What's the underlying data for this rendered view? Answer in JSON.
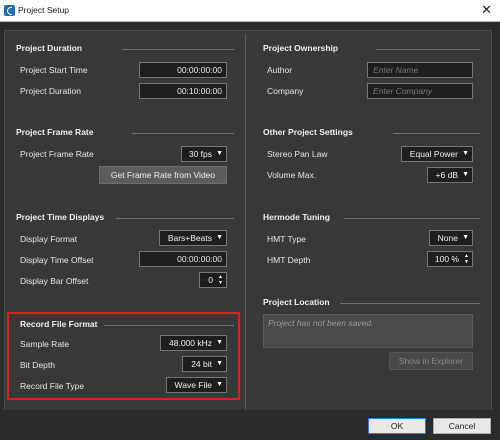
{
  "window": {
    "title": "Project Setup",
    "close_glyph": "✕"
  },
  "sections": {
    "project_duration": {
      "title": "Project Duration",
      "start_time_label": "Project Start Time",
      "start_time_value": "00:00:00:00",
      "duration_label": "Project Duration",
      "duration_value": "00:10:00:00"
    },
    "project_frame_rate": {
      "title": "Project Frame Rate",
      "frame_rate_label": "Project Frame Rate",
      "frame_rate_value": "30 fps",
      "get_from_video_button": "Get Frame Rate from Video"
    },
    "project_time_displays": {
      "title": "Project Time Displays",
      "display_format_label": "Display Format",
      "display_format_value": "Bars+Beats",
      "time_offset_label": "Display Time Offset",
      "time_offset_value": "00:00:00:00",
      "bar_offset_label": "Display Bar Offset",
      "bar_offset_value": "0"
    },
    "record_file_format": {
      "title": "Record File Format",
      "sample_rate_label": "Sample Rate",
      "sample_rate_value": "48.000 kHz",
      "bit_depth_label": "Bit Depth",
      "bit_depth_value": "24 bit",
      "file_type_label": "Record File Type",
      "file_type_value": "Wave File"
    },
    "project_ownership": {
      "title": "Project Ownership",
      "author_label": "Author",
      "author_placeholder": "Enter Name",
      "company_label": "Company",
      "company_placeholder": "Enter Company"
    },
    "other_project_settings": {
      "title": "Other Project Settings",
      "stereo_pan_law_label": "Stereo Pan Law",
      "stereo_pan_law_value": "Equal Power",
      "volume_max_label": "Volume Max.",
      "volume_max_value": "+6 dB"
    },
    "hermode_tuning": {
      "title": "Hermode Tuning",
      "hmt_type_label": "HMT Type",
      "hmt_type_value": "None",
      "hmt_depth_label": "HMT Depth",
      "hmt_depth_value": "100 %"
    },
    "project_location": {
      "title": "Project Location",
      "status_text": "Project has not been saved.",
      "show_in_explorer_button": "Show in Explorer"
    }
  },
  "footer": {
    "ok_label": "OK",
    "cancel_label": "Cancel"
  },
  "icons": {
    "dropdown_arrow": "▼",
    "spin_up": "▲",
    "spin_down": "▼"
  },
  "colors": {
    "highlight_border": "#e02020",
    "panel_bg": "#383838",
    "field_bg": "#1e1e1e",
    "primary_button_border": "#2a7fd4"
  }
}
